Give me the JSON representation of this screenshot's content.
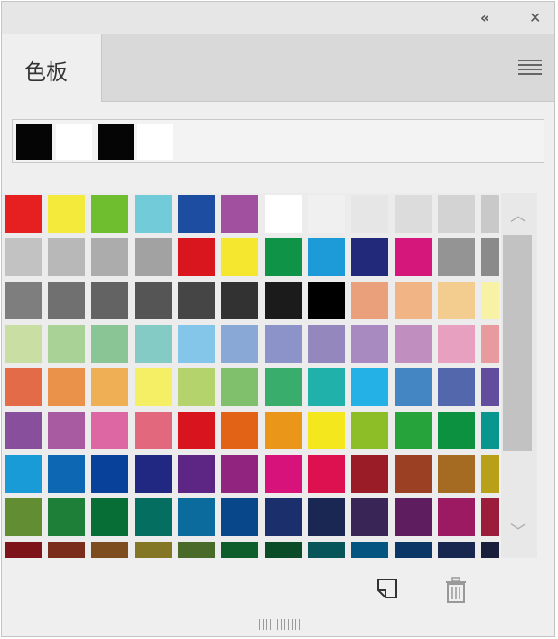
{
  "panel": {
    "tab_label": "色板",
    "titlebar_icons": [
      "collapse-icon",
      "close-icon"
    ],
    "menu_icon": "panel-menu-icon",
    "footer_icons": [
      "new-swatch-icon",
      "delete-swatch-icon"
    ]
  },
  "recent_colors": [
    "#050505",
    "#ffffff",
    "#050505",
    "#ffffff"
  ],
  "swatches": [
    [
      "#e62020",
      "#f3ea3b",
      "#6ebe30",
      "#72cbd8",
      "#1d4da1",
      "#a150a0",
      "#ffffff",
      "#f0f0f0",
      "#e6e6e6",
      "#dcdcdc",
      "#d3d3d3",
      "#c9c9c9"
    ],
    [
      "#c2c2c2",
      "#b8b8b8",
      "#acacac",
      "#a2a2a2",
      "#d9161e",
      "#f5e630",
      "#0f9447",
      "#1d9ad8",
      "#23297a",
      "#d5167b",
      "#949494",
      "#8a8a8a"
    ],
    [
      "#7e7e7e",
      "#707070",
      "#636363",
      "#555555",
      "#454545",
      "#323232",
      "#1b1b1b",
      "#000000",
      "#eba07c",
      "#f0b485",
      "#f3cc8f",
      "#f8f2a6"
    ],
    [
      "#c8dea2",
      "#a9d297",
      "#89c595",
      "#85cbc5",
      "#83c6ea",
      "#8aa8d6",
      "#8c93c8",
      "#9487be",
      "#a98ac0",
      "#c08ebf",
      "#e8a0c1",
      "#e89b9e"
    ],
    [
      "#e36b47",
      "#eb924a",
      "#efb055",
      "#f5ef65",
      "#b5d36d",
      "#80bf6c",
      "#38ad6c",
      "#1fb1aa",
      "#24b1e5",
      "#4386c3",
      "#5368ac",
      "#624c9e"
    ],
    [
      "#874f9c",
      "#a85ba0",
      "#dc67a2",
      "#e2697d",
      "#d8141e",
      "#e26316",
      "#ea9618",
      "#f4e71e",
      "#8ebe27",
      "#26a43b",
      "#0b913f",
      "#09968e"
    ],
    [
      "#189bd7",
      "#0e67b2",
      "#07419a",
      "#212881",
      "#5d2685",
      "#90247f",
      "#d7137b",
      "#de1150",
      "#9a1c27",
      "#9b4023",
      "#a56b22",
      "#b8a118"
    ],
    [
      "#628d33",
      "#1e7f39",
      "#076e36",
      "#046f61",
      "#0b6b9d",
      "#07478a",
      "#1a2f6b",
      "#1a2753",
      "#392656",
      "#5e1d5e",
      "#9b1a62",
      "#9c1c3b"
    ],
    [
      "#7d141a",
      "#7b2d1c",
      "#7d4d1f",
      "#837725",
      "#4a6a2a",
      "#0e5e2b",
      "#0a4c28",
      "#075459",
      "#04557f",
      "#0a3766",
      "#18274f",
      "#191f3b"
    ]
  ]
}
